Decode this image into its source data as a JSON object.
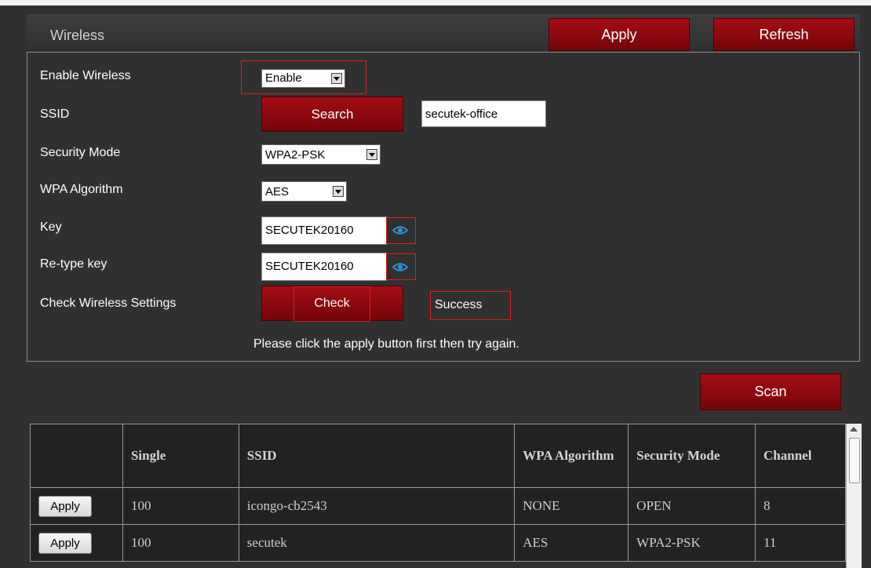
{
  "header": {
    "title": "Wireless",
    "apply_label": "Apply",
    "refresh_label": "Refresh"
  },
  "form": {
    "enable_wireless_label": "Enable Wireless",
    "enable_wireless_value": "Enable",
    "ssid_label": "SSID",
    "search_label": "Search",
    "ssid_value": "secutek-office",
    "security_mode_label": "Security Mode",
    "security_mode_value": "WPA2-PSK",
    "wpa_algorithm_label": "WPA Algorithm",
    "wpa_algorithm_value": "AES",
    "key_label": "Key",
    "key_value": "SECUTEK20160",
    "retype_key_label": "Re-type key",
    "retype_key_value": "SECUTEK20160",
    "check_label": "Check Wireless Settings",
    "check_button_label": "Check",
    "check_status": "Success",
    "notice": "Please click the apply button first then try again."
  },
  "scan_label": "Scan",
  "results": {
    "columns": [
      "",
      "Single",
      "SSID",
      "WPA Algorithm",
      "Security Mode",
      "Channel"
    ],
    "rows": [
      {
        "action": "Apply",
        "single": "100",
        "ssid": "icongo-cb2543",
        "wpa": "NONE",
        "security": "OPEN",
        "channel": "8"
      },
      {
        "action": "Apply",
        "single": "100",
        "ssid": "secutek",
        "wpa": "AES",
        "security": "WPA2-PSK",
        "channel": "11"
      }
    ]
  },
  "icons": {
    "eye": "eye-icon",
    "dropdown": "chevron-down-icon"
  },
  "colors": {
    "background": "#303030",
    "button_red": "#8f0a0e",
    "highlight_red": "#e51c1c",
    "eye_blue": "#2f8fd8"
  }
}
